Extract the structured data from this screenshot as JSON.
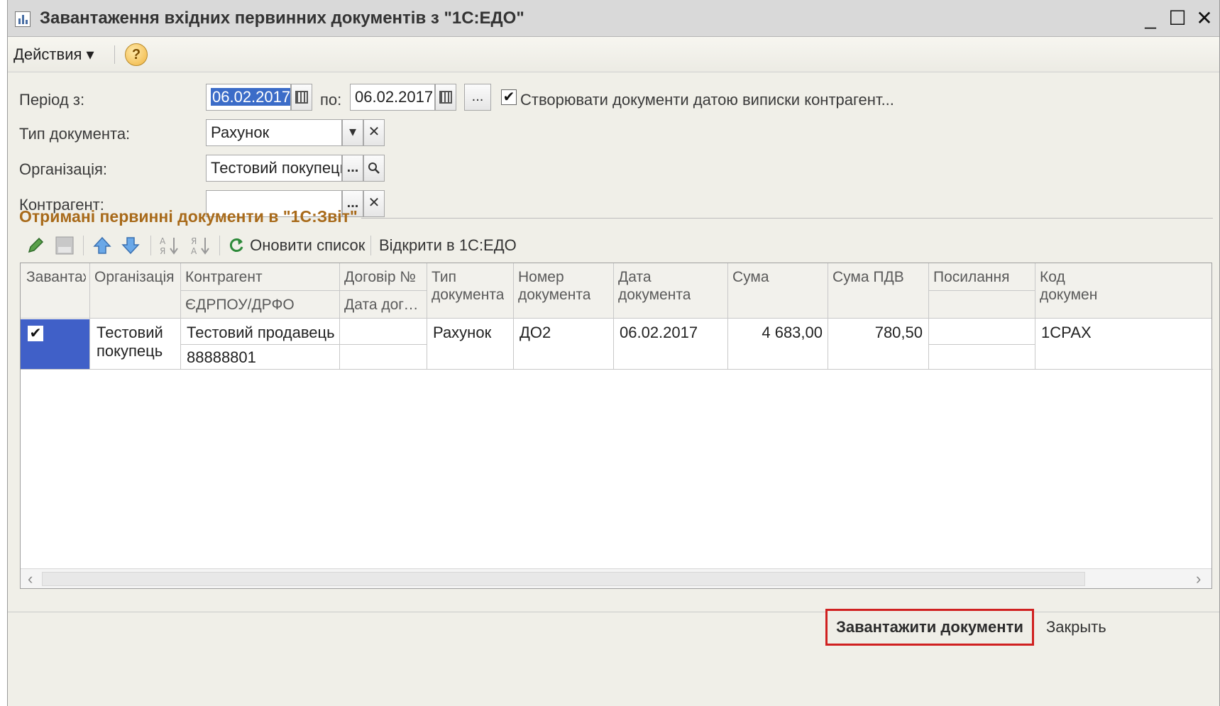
{
  "window": {
    "title": "Завантаження вхідних первинних документів з \"1С:ЕДО\"",
    "minimize": "_",
    "maximize": "☐",
    "close": "✕"
  },
  "menu": {
    "actions": "Действия ▾",
    "help": "?"
  },
  "form": {
    "period_label": "Період з:",
    "period_from": "06.02.2017",
    "period_to_label": "по:",
    "period_to": "06.02.2017",
    "period_btn": "...",
    "create_by_date_checked": "✔",
    "create_by_date_label": "Створювати документи датою виписки контрагент...",
    "doc_type_label": "Тип документа:",
    "doc_type_value": "Рахунок",
    "org_label": "Організація:",
    "org_value": "Тестовий покупець",
    "contractor_label": "Контрагент:",
    "contractor_value": "",
    "dots": "...",
    "clear": "✕",
    "dropdown": "▾",
    "search": "🔍"
  },
  "section": {
    "title": "Отримані первинні документи в \"1С:Звіт\""
  },
  "toolbar": {
    "refresh": "Оновити список",
    "open_edo": "Відкрити в 1С:ЕДО"
  },
  "table": {
    "headers": {
      "load": "Завантажити",
      "org": "Організація",
      "contractor": "Контрагент",
      "edrpou": "ЄДРПОУ/ДРФО",
      "contract_no": "Договір №",
      "contract_date": "Дата договору",
      "doc_type_1": "Тип",
      "doc_type_2": "документа",
      "doc_no_1": "Номер",
      "doc_no_2": "документа",
      "doc_date_1": "Дата",
      "doc_date_2": "документа",
      "sum": "Сума",
      "vat": "Сума ПДВ",
      "link": "Посилання",
      "code_1": "Код",
      "code_2": "документа"
    },
    "rows": [
      {
        "checked": "✔",
        "org_1": "Тестовий",
        "org_2": "покупець",
        "contractor": "Тестовий продавець",
        "edrpou": "88888801",
        "doc_type": "Рахунок",
        "doc_no": "ДО2",
        "doc_date": "06.02.2017",
        "sum": "4 683,00",
        "vat": "780,50",
        "code": "1СРАХ"
      }
    ]
  },
  "footer": {
    "load_btn": "Завантажити документи",
    "close_btn": "Закрыть"
  },
  "colors": {
    "accent_red": "#d02020",
    "selection": "#4060c8",
    "section_title": "#a86a1a"
  }
}
